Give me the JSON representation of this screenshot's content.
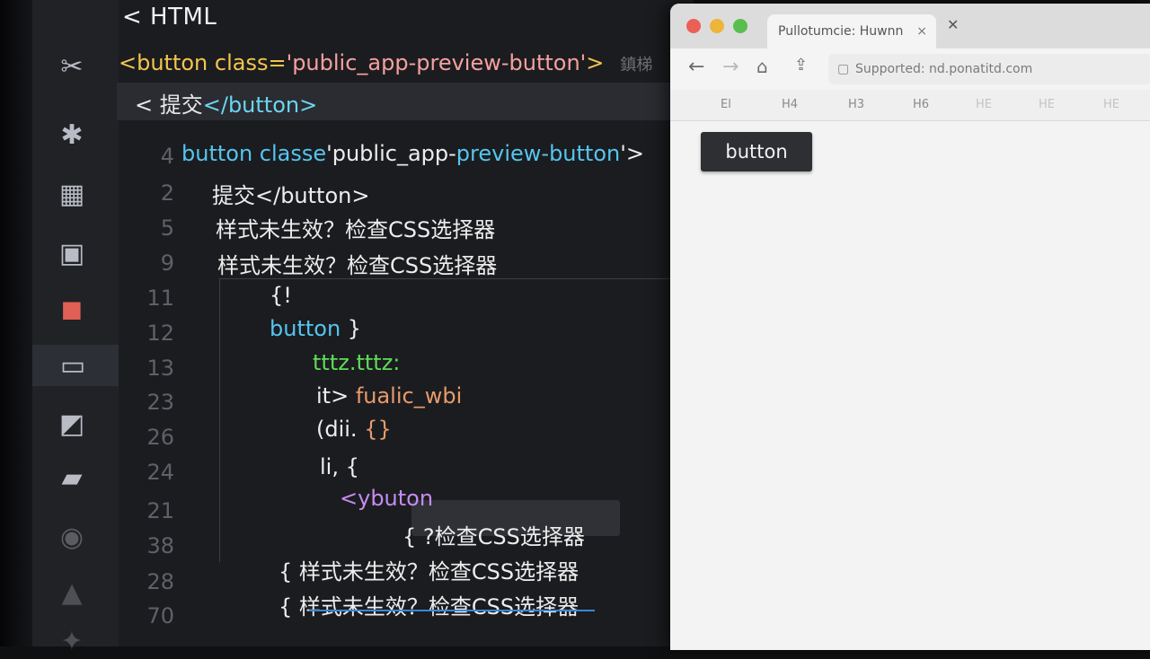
{
  "editor": {
    "tab_title": "< HTML",
    "top_line": {
      "tag_open": "<button class=",
      "class_value": "'public_app-preview-button'",
      "tag_close": ">",
      "faint": "鎮梯"
    },
    "second_line": {
      "lt": "< ",
      "text": "提交",
      "close_tag": "</button>"
    },
    "lines": [
      {
        "num": "4",
        "parts": [
          {
            "t": "button classe",
            "c": "blue"
          },
          {
            "t": "'public_app-",
            "c": "white"
          },
          {
            "t": "preview-button",
            "c": "blue"
          },
          {
            "t": "'>",
            "c": "white"
          }
        ]
      },
      {
        "num": "2",
        "parts": [
          {
            "t": "提交</button>",
            "c": "white"
          }
        ]
      },
      {
        "num": "5",
        "parts": [
          {
            "t": "样式未生效？检查CSS选择器",
            "c": "white"
          }
        ]
      },
      {
        "num": "9",
        "parts": [
          {
            "t": "样式未生效？检查CSS选择器",
            "c": "white"
          }
        ]
      },
      {
        "num": "11",
        "parts": [
          {
            "t": "{!",
            "c": "white"
          }
        ]
      },
      {
        "num": "12",
        "parts": [
          {
            "t": "button",
            "c": "blue"
          },
          {
            "t": " }",
            "c": "white"
          }
        ]
      },
      {
        "num": "13",
        "parts": [
          {
            "t": "tttz.tttz:",
            "c": "green"
          }
        ]
      },
      {
        "num": "23",
        "parts": [
          {
            "t": "it>",
            "c": "white"
          },
          {
            "t": " fualic_wbi",
            "c": "orange"
          }
        ]
      },
      {
        "num": "26",
        "parts": [
          {
            "t": "(dii.",
            "c": "white"
          },
          {
            "t": "        {}",
            "c": "orange"
          }
        ]
      },
      {
        "num": "24",
        "parts": [
          {
            "t": "li, {",
            "c": "white"
          }
        ]
      },
      {
        "num": "21",
        "parts": [
          {
            "t": "<y",
            "c": "purple"
          },
          {
            "t": "buton",
            "c": "purple"
          }
        ]
      },
      {
        "num": "38",
        "parts": [
          {
            "t": "{ ?检查CSS选择器",
            "c": "white"
          }
        ]
      },
      {
        "num": "28",
        "parts": [
          {
            "t": "{  样式未生效？检查CSS选择器",
            "c": "white"
          }
        ]
      },
      {
        "num": "70",
        "parts": [
          {
            "t": "{  样式未生效？检查CSS选择器",
            "c": "white"
          }
        ]
      }
    ]
  },
  "activity_icons": [
    "wrench-icon",
    "puzzle-icon",
    "layout-icon",
    "file-icon",
    "extensions-icon",
    "chat-icon",
    "cloud-icon",
    "terminal-icon",
    "globe-icon",
    "bell-icon",
    "star-icon"
  ],
  "browser": {
    "tab_title": "Pullotumcie: Huwnn",
    "tab_close": "×",
    "new_tab": "✕",
    "url": "Supported: nd.ponatitd.com",
    "bookmarks": [
      "El",
      "H4",
      "H3",
      "H6",
      "HE",
      "HE",
      "HE"
    ],
    "preview_button_label": "button"
  }
}
